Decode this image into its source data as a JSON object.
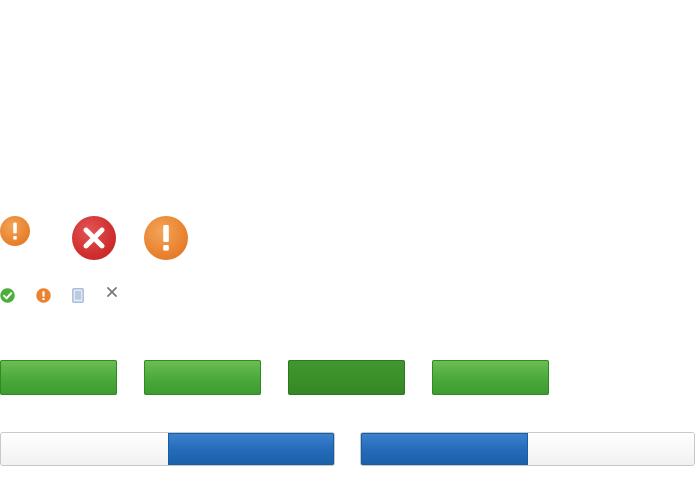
{
  "icons": {
    "large": [
      "warning-icon",
      "error-icon",
      "warning-icon"
    ],
    "small": [
      "check-icon",
      "warning-icon",
      "document-icon",
      "close-icon"
    ]
  },
  "buttons": {
    "green": [
      {
        "label": "",
        "state": "normal"
      },
      {
        "label": "",
        "state": "normal"
      },
      {
        "label": "",
        "state": "pressed"
      },
      {
        "label": "",
        "state": "normal"
      }
    ]
  },
  "toggles": [
    {
      "options": [
        "",
        ""
      ],
      "selected_index": 1
    },
    {
      "options": [
        "",
        ""
      ],
      "selected_index": 0
    }
  ],
  "colors": {
    "green": "#4ba83b",
    "green_pressed": "#3a8f29",
    "blue": "#236bb8",
    "warning": "#e9832f",
    "error": "#cf2f2f",
    "check": "#4caf3c"
  }
}
